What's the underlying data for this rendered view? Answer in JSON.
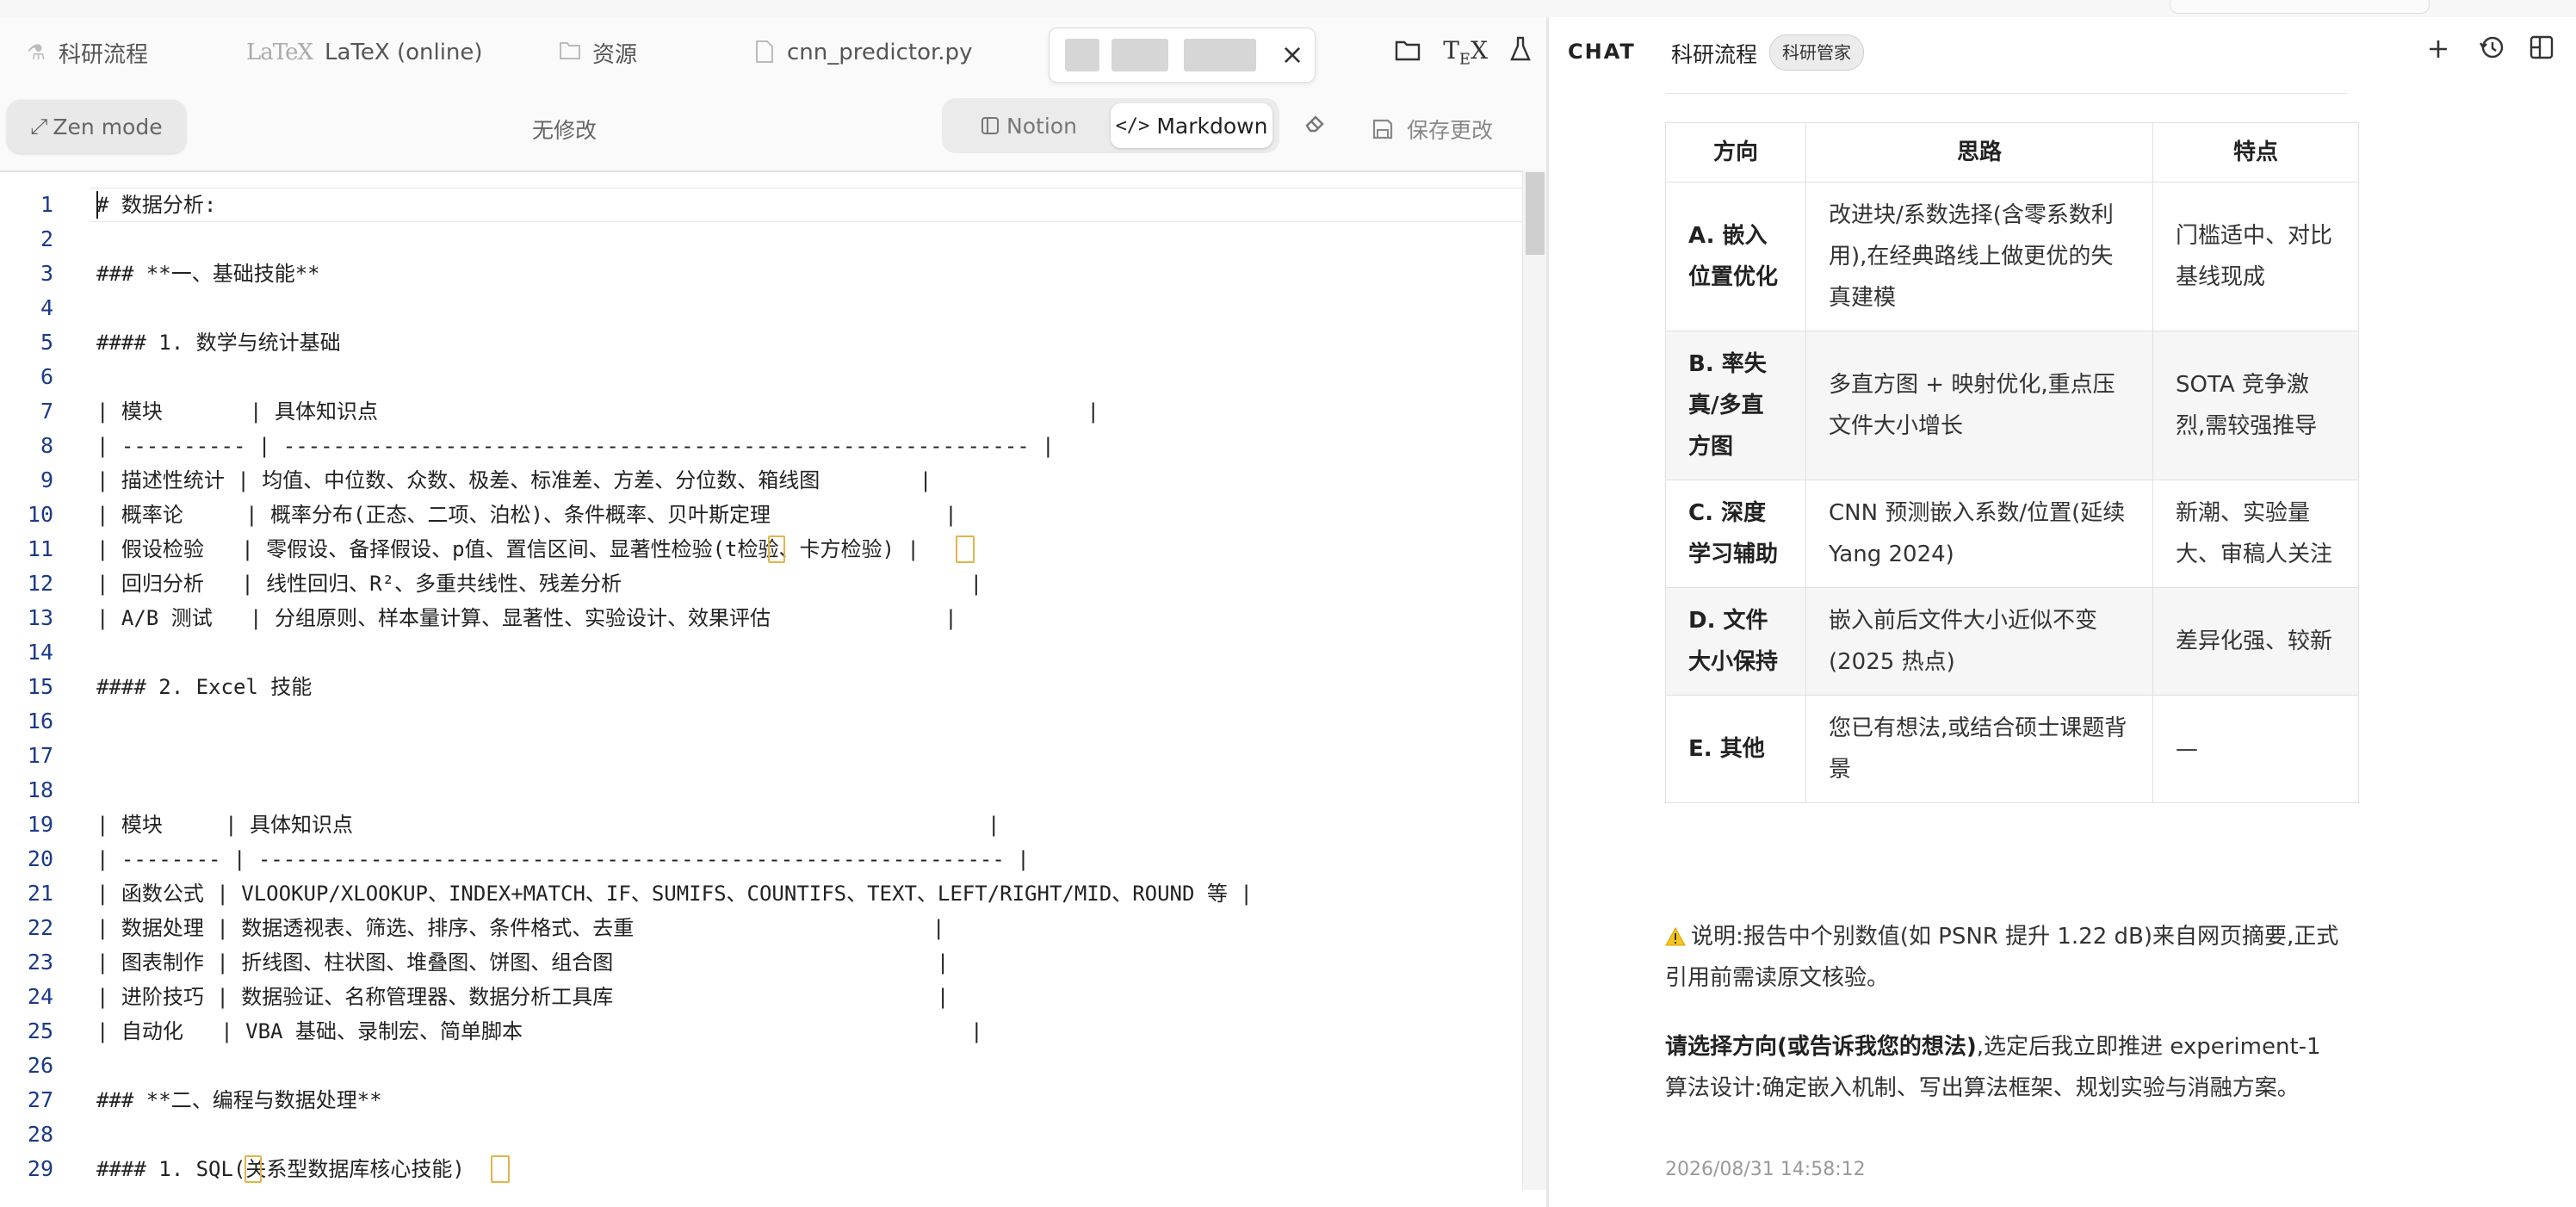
{
  "tabs": {
    "items": [
      {
        "label": "科研流程",
        "icon": "flask-icon"
      },
      {
        "label": "LaTeX (online)",
        "icon": "latex-logo-icon"
      },
      {
        "label": "资源",
        "icon": "folder-icon"
      },
      {
        "label": "cnn_predictor.py",
        "icon": "file-icon"
      }
    ],
    "latex_mark": "LaTeX",
    "active_close": "×"
  },
  "toolbar": {
    "zen_label": "Zen mode",
    "status": "无修改",
    "notion_label": "Notion",
    "markdown_label": "Markdown",
    "save_label": "保存更改"
  },
  "editor": {
    "lines": [
      {
        "n": "1",
        "text": "# 数据分析:"
      },
      {
        "n": "2",
        "text": ""
      },
      {
        "n": "3",
        "text": "### **一、基础技能**"
      },
      {
        "n": "4",
        "text": ""
      },
      {
        "n": "5",
        "text": "#### 1. 数学与统计基础"
      },
      {
        "n": "6",
        "text": ""
      },
      {
        "n": "7",
        "text": "| 模块       | 具体知识点                                                         |"
      },
      {
        "n": "8",
        "text": "| ---------- | ------------------------------------------------------------ |"
      },
      {
        "n": "9",
        "text": "| 描述性统计 | 均值、中位数、众数、极差、标准差、方差、分位数、箱线图        |"
      },
      {
        "n": "10",
        "text": "| 概率论     | 概率分布(正态、二项、泊松)、条件概率、贝叶斯定理              |"
      },
      {
        "n": "11",
        "text": "| 假设检验   | 零假设、备择假设、p值、置信区间、显著性检验(t检验、卡方检验) |"
      },
      {
        "n": "12",
        "text": "| 回归分析   | 线性回归、R²、多重共线性、残差分析                            |"
      },
      {
        "n": "13",
        "text": "| A/B 测试   | 分组原则、样本量计算、显著性、实验设计、效果评估              |"
      },
      {
        "n": "14",
        "text": ""
      },
      {
        "n": "15",
        "text": "#### 2. Excel 技能"
      },
      {
        "n": "16",
        "text": ""
      },
      {
        "n": "17",
        "text": ""
      },
      {
        "n": "18",
        "text": ""
      },
      {
        "n": "19",
        "text": "| 模块     | 具体知识点                                                   |"
      },
      {
        "n": "20",
        "text": "| -------- | ------------------------------------------------------------ |"
      },
      {
        "n": "21",
        "text": "| 函数公式 | VLOOKUP/XLOOKUP、INDEX+MATCH、IF、SUMIFS、COUNTIFS、TEXT、LEFT/RIGHT/MID、ROUND 等 |"
      },
      {
        "n": "22",
        "text": "| 数据处理 | 数据透视表、筛选、排序、条件格式、去重                        |"
      },
      {
        "n": "23",
        "text": "| 图表制作 | 折线图、柱状图、堆叠图、饼图、组合图                          |"
      },
      {
        "n": "24",
        "text": "| 进阶技巧 | 数据验证、名称管理器、数据分析工具库                          |"
      },
      {
        "n": "25",
        "text": "| 自动化   | VBA 基础、录制宏、简单脚本                                    |"
      },
      {
        "n": "26",
        "text": ""
      },
      {
        "n": "27",
        "text": "### **二、编程与数据处理**"
      },
      {
        "n": "28",
        "text": ""
      },
      {
        "n": "29",
        "text": "#### 1. SQL(关系型数据库核心技能)"
      }
    ]
  },
  "chat": {
    "header_label": "CHAT",
    "project": "科研流程",
    "badge": "科研管家",
    "table": {
      "headers": [
        "方向",
        "思路",
        "特点"
      ],
      "rows": [
        {
          "dir": "A. 嵌入位置优化",
          "idea": "改进块/系数选择(含零系数利用),在经典路线上做更优的失真建模",
          "feature": "门槛适中、对比基线现成"
        },
        {
          "dir": "B. 率失真/多直方图",
          "idea": "多直方图 + 映射优化,重点压文件大小增长",
          "feature": "SOTA 竞争激烈,需较强推导"
        },
        {
          "dir": "C. 深度学习辅助",
          "idea": "CNN 预测嵌入系数/位置(延续 Yang 2024)",
          "feature": "新潮、实验量大、审稿人关注"
        },
        {
          "dir": "D. 文件大小保持",
          "idea": "嵌入前后文件大小近似不变(2025 热点)",
          "feature": "差异化强、较新"
        },
        {
          "dir": "E. 其他",
          "idea": "您已有想法,或结合硕士课题背景",
          "feature": "—"
        }
      ]
    },
    "note": "说明:报告中个别数值(如 PSNR 提升 1.22 dB)来自网页摘要,正式引用前需读原文核验。",
    "prompt_bold": "请选择方向(或告诉我您的想法)",
    "prompt_rest": ",选定后我立即推进 experiment-1 算法设计:确定嵌入机制、写出算法框架、规划实验与消融方案。",
    "timestamp": "2026/08/31 14:58:12"
  }
}
